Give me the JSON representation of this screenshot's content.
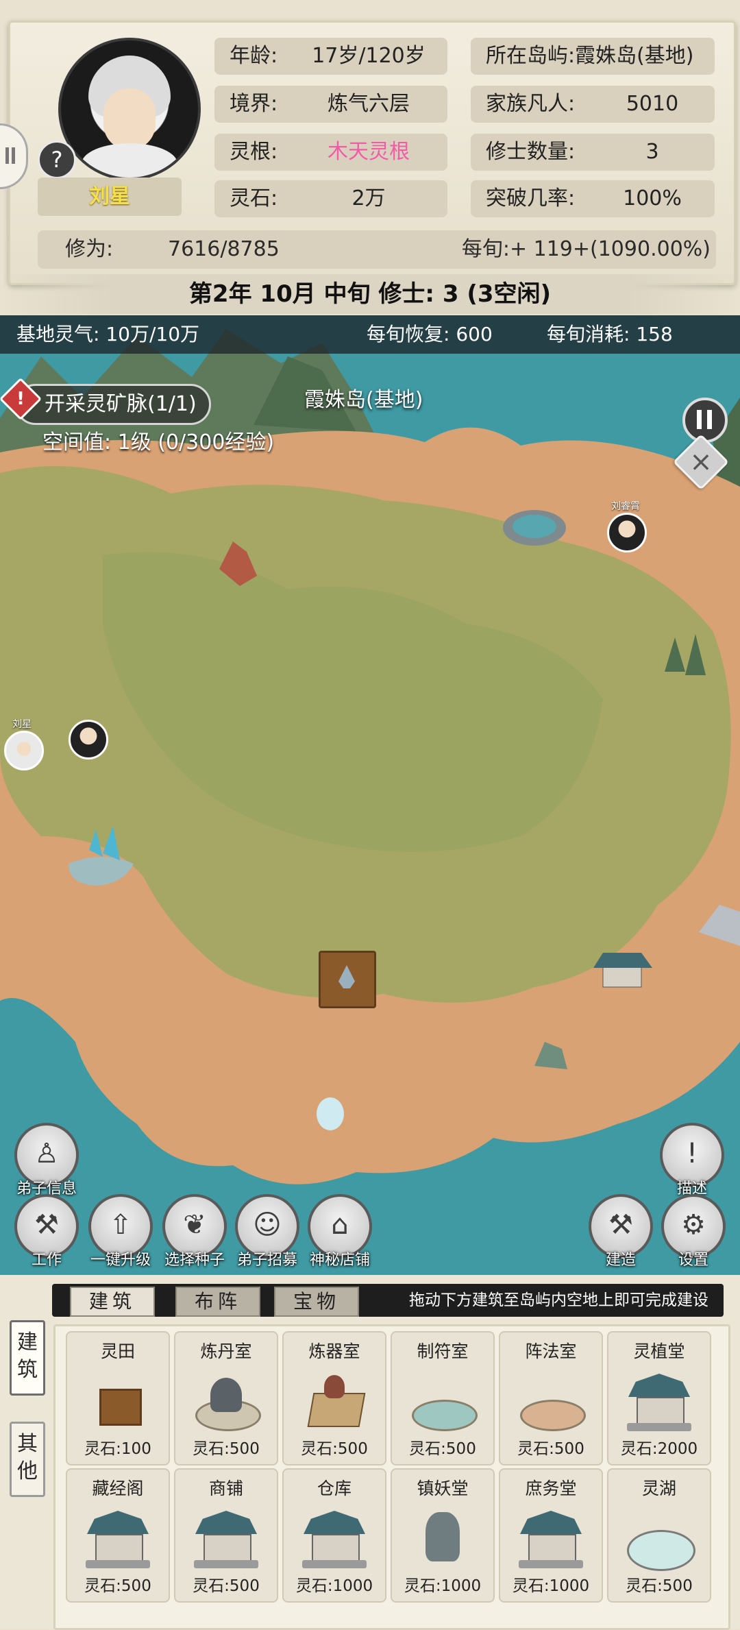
{
  "player": {
    "name": "刘星",
    "age_label": "年龄:",
    "age_value": "17岁/120岁",
    "realm_label": "境界:",
    "realm_value": "炼气六层",
    "root_label": "灵根:",
    "root_value": "木天灵根",
    "stone_label": "灵石:",
    "stone_value": "2万",
    "cultivation_label": "修为:",
    "cultivation_value": "7616/8785",
    "per_xun_value": "每旬:+ 119+(1090.00%)"
  },
  "island": {
    "location_value": "所在岛屿:霞姝岛(基地)",
    "family_label": "家族凡人:",
    "family_value": "5010",
    "cultivators_label": "修士数量:",
    "cultivators_value": "3",
    "breakthrough_label": "突破几率:",
    "breakthrough_value": "100%"
  },
  "date_banner": "第2年 10月 中旬    修士: 3 (3空闲)",
  "map": {
    "base_qi": "基地灵气: 10万/10万",
    "recovery": "每旬恢复: 600",
    "consumption": "每旬消耗: 158",
    "task": "开采灵矿脉(1/1)",
    "space_level": "空间值: 1级 (0/300经验)",
    "island_name": "霞姝岛(基地)",
    "disciples": [
      "刘星",
      "刘睿霄"
    ],
    "buttons": {
      "disciple_info": "弟子信息",
      "describe": "描述",
      "work": "工作",
      "upgrade": "一键升级",
      "seeds": "选择种子",
      "recruit": "弟子招募",
      "shop": "神秘店铺",
      "build": "建造",
      "settings": "设置"
    }
  },
  "build_panel": {
    "side_tabs": [
      "建筑",
      "其他"
    ],
    "tabs": [
      "建筑",
      "布阵",
      "宝物"
    ],
    "hint": "拖动下方建筑至岛屿内空地上即可完成建设",
    "buildings": [
      {
        "name": "灵田",
        "cost": "灵石:100"
      },
      {
        "name": "炼丹室",
        "cost": "灵石:500"
      },
      {
        "name": "炼器室",
        "cost": "灵石:500"
      },
      {
        "name": "制符室",
        "cost": "灵石:500"
      },
      {
        "name": "阵法室",
        "cost": "灵石:500"
      },
      {
        "name": "灵植堂",
        "cost": "灵石:2000"
      },
      {
        "name": "藏经阁",
        "cost": "灵石:500"
      },
      {
        "name": "商铺",
        "cost": "灵石:500"
      },
      {
        "name": "仓库",
        "cost": "灵石:1000"
      },
      {
        "name": "镇妖堂",
        "cost": "灵石:1000"
      },
      {
        "name": "庶务堂",
        "cost": "灵石:1000"
      },
      {
        "name": "灵湖",
        "cost": "灵石:500"
      }
    ]
  },
  "colors": {
    "accent_pink": "#f05ca8",
    "name_yellow": "#f6e04a",
    "sea": "#3f9aa3",
    "sand": "#d9a274",
    "grass": "#a6a765"
  }
}
